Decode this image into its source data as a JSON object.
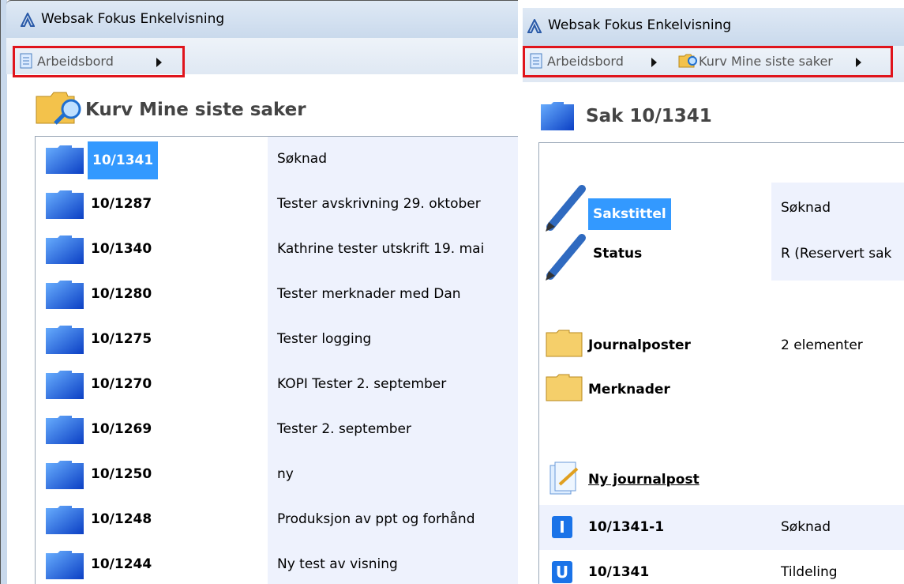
{
  "left": {
    "window_title": "Websak Fokus Enkelvisning",
    "breadcrumb": [
      "Arbeidsbord"
    ],
    "header": "Kurv Mine siste saker",
    "rows": [
      {
        "case": "10/1341",
        "desc": "Søknad"
      },
      {
        "case": "10/1287",
        "desc": "Tester avskrivning 29. oktober"
      },
      {
        "case": "10/1340",
        "desc": "Kathrine tester utskrift 19. mai"
      },
      {
        "case": "10/1280",
        "desc": "Tester merknader med Dan"
      },
      {
        "case": "10/1275",
        "desc": "Tester logging"
      },
      {
        "case": "10/1270",
        "desc": "KOPI Tester 2. september"
      },
      {
        "case": "10/1269",
        "desc": "Tester 2. september"
      },
      {
        "case": "10/1250",
        "desc": "ny"
      },
      {
        "case": "10/1248",
        "desc": "Produksjon av ppt og forhånd"
      },
      {
        "case": "10/1244",
        "desc": "Ny test av visning"
      }
    ]
  },
  "right": {
    "window_title": "Websak Fokus Enkelvisning",
    "breadcrumb": [
      "Arbeidsbord",
      "Kurv Mine siste saker"
    ],
    "header": "Sak 10/1341",
    "fields": [
      {
        "label": "Sakstittel",
        "value": "Søknad"
      },
      {
        "label": "Status",
        "value": "R (Reservert sak"
      }
    ],
    "folders": [
      {
        "label": "Journalposter",
        "value": "2 elementer"
      },
      {
        "label": "Merknader",
        "value": ""
      }
    ],
    "new_link": "Ny journalpost",
    "entries": [
      {
        "badge": "I",
        "num": "10/1341-1",
        "desc": "Søknad"
      },
      {
        "badge": "U",
        "num": "10/1341",
        "desc": "Tildeling"
      }
    ]
  },
  "colors": {
    "highlight": "#3399ff",
    "breadcrumb_box": "#e0141c",
    "row_bg": "#eef2fd",
    "badge": "#1a73e8"
  }
}
